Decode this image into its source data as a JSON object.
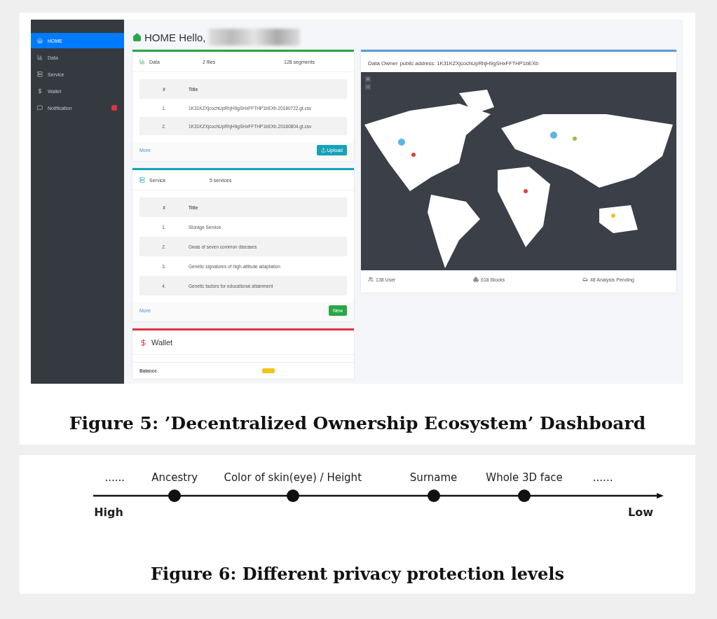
{
  "figure5": {
    "screenshot": {
      "sidebar": {
        "items": [
          {
            "label": "HOME",
            "selected": true
          },
          {
            "label": "Data",
            "selected": false
          },
          {
            "label": "Service",
            "selected": false
          },
          {
            "label": "Wallet",
            "selected": false
          },
          {
            "label": "Notification",
            "selected": false,
            "badge": true
          }
        ]
      },
      "header": "HOME Hello,",
      "data_card": {
        "title": "Data",
        "files": "2 files",
        "segments": "128 segments",
        "columns": [
          "#",
          "Title"
        ],
        "rows": [
          {
            "number": "1.",
            "title": "1K31KZXjcochUpRhjH9gSHxFFTHP1bEXb.20180722.gt.csv"
          },
          {
            "number": "2.",
            "title": "1K31KZXjcochUpRhjH9gSHxFFTHP1bEXb.20180804.gt.csv"
          }
        ],
        "more": "More",
        "button": "Upload"
      },
      "service_card": {
        "title": "Service",
        "count": "5 services",
        "columns": [
          "#",
          "Title"
        ],
        "rows": [
          {
            "number": "1.",
            "title": "Storage Service"
          },
          {
            "number": "2.",
            "title": "Gwas of seven common diseases"
          },
          {
            "number": "3.",
            "title": "Genetic signatures of high-altitude adaptation"
          },
          {
            "number": "4.",
            "title": "Genetic factors for educational attainment"
          }
        ],
        "more": "More",
        "button": "New"
      },
      "wallet_card": {
        "title": "Wallet",
        "balance_label": "Balance"
      },
      "map_card": {
        "title": "Data Owner",
        "address": "public address: 1K31KZXjcochUpRhjH9gSHxFFTHP1bEXb",
        "map": {
          "kind": "picture"
        },
        "stats": [
          "138 User",
          "618 Blocks",
          "48 Analysis Pending"
        ]
      }
    },
    "caption": "Figure 5: ’Decentralized Ownership Ecosystem’ Dashboard"
  },
  "figure6": {
    "labels": [
      "......",
      "Ancestry",
      "Color of skin(eye) / Height",
      "Surname",
      "Whole 3D face",
      "......"
    ],
    "high": "High",
    "low": "Low",
    "caption": "Figure 6: Different privacy protection levels"
  }
}
